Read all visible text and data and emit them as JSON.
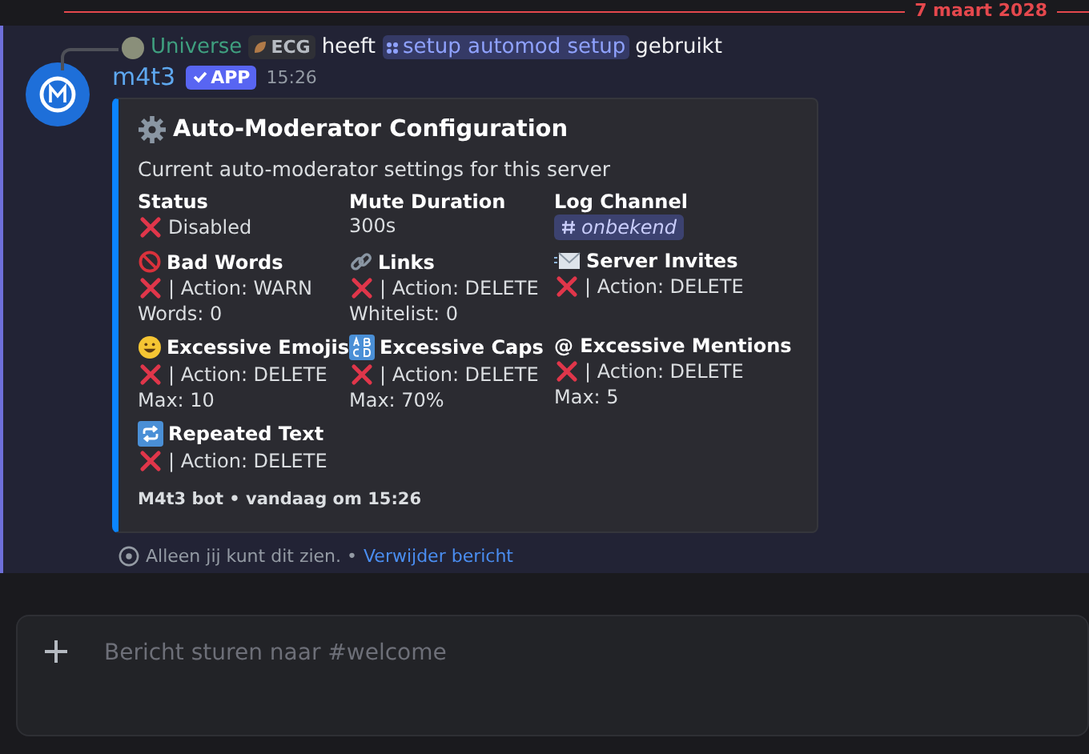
{
  "date_divider": "7 maart 2028",
  "reply": {
    "user": "Universe",
    "tag": "ECG",
    "verb": "heeft",
    "command": "setup automod setup",
    "suffix": "gebruikt"
  },
  "message": {
    "author": "m4t3",
    "badge": "APP",
    "time": "15:26",
    "embed": {
      "title": "Auto-Moderator Configuration",
      "description": "Current auto-moderator settings for this server",
      "fields": [
        {
          "kind": "plain",
          "name": "Status",
          "lines": [
            {
              "kind": "cross",
              "text": "Disabled"
            }
          ]
        },
        {
          "kind": "plain",
          "name": "Mute Duration",
          "lines": [
            {
              "kind": "plain",
              "text": "300s"
            }
          ]
        },
        {
          "kind": "plain",
          "name": "Log Channel",
          "lines": [
            {
              "kind": "channel",
              "text": "onbekend"
            }
          ]
        },
        {
          "kind": "prohibited",
          "name": "Bad Words",
          "lines": [
            {
              "kind": "cross",
              "text": "| Action: WARN"
            },
            {
              "kind": "plain",
              "text": "Words: 0"
            }
          ]
        },
        {
          "kind": "link",
          "name": "Links",
          "lines": [
            {
              "kind": "cross",
              "text": "| Action: DELETE"
            },
            {
              "kind": "plain",
              "text": "Whitelist: 0"
            }
          ]
        },
        {
          "kind": "envelope",
          "name": "Server Invites",
          "lines": [
            {
              "kind": "cross",
              "text": "| Action: DELETE"
            }
          ]
        },
        {
          "kind": "smiley",
          "name": "Excessive Emojis",
          "lines": [
            {
              "kind": "cross",
              "text": "| Action: DELETE"
            },
            {
              "kind": "plain",
              "text": "Max: 10"
            }
          ]
        },
        {
          "kind": "letters",
          "name": "Excessive Caps",
          "lines": [
            {
              "kind": "cross",
              "text": "| Action: DELETE"
            },
            {
              "kind": "plain",
              "text": "Max: 70%"
            }
          ]
        },
        {
          "kind": "plain",
          "name": "@ Excessive Mentions",
          "lines": [
            {
              "kind": "cross",
              "text": "| Action: DELETE"
            },
            {
              "kind": "plain",
              "text": "Max: 5"
            }
          ]
        },
        {
          "kind": "repeat",
          "name": "Repeated Text",
          "lines": [
            {
              "kind": "cross",
              "text": "| Action: DELETE"
            }
          ]
        }
      ],
      "footer": "M4t3 bot • vandaag om 15:26"
    },
    "ephemeral_note": "Alleen jij kunt dit zien. •",
    "ephemeral_link": "Verwijder bericht"
  },
  "composer": {
    "placeholder": "Bericht sturen naar #welcome"
  }
}
